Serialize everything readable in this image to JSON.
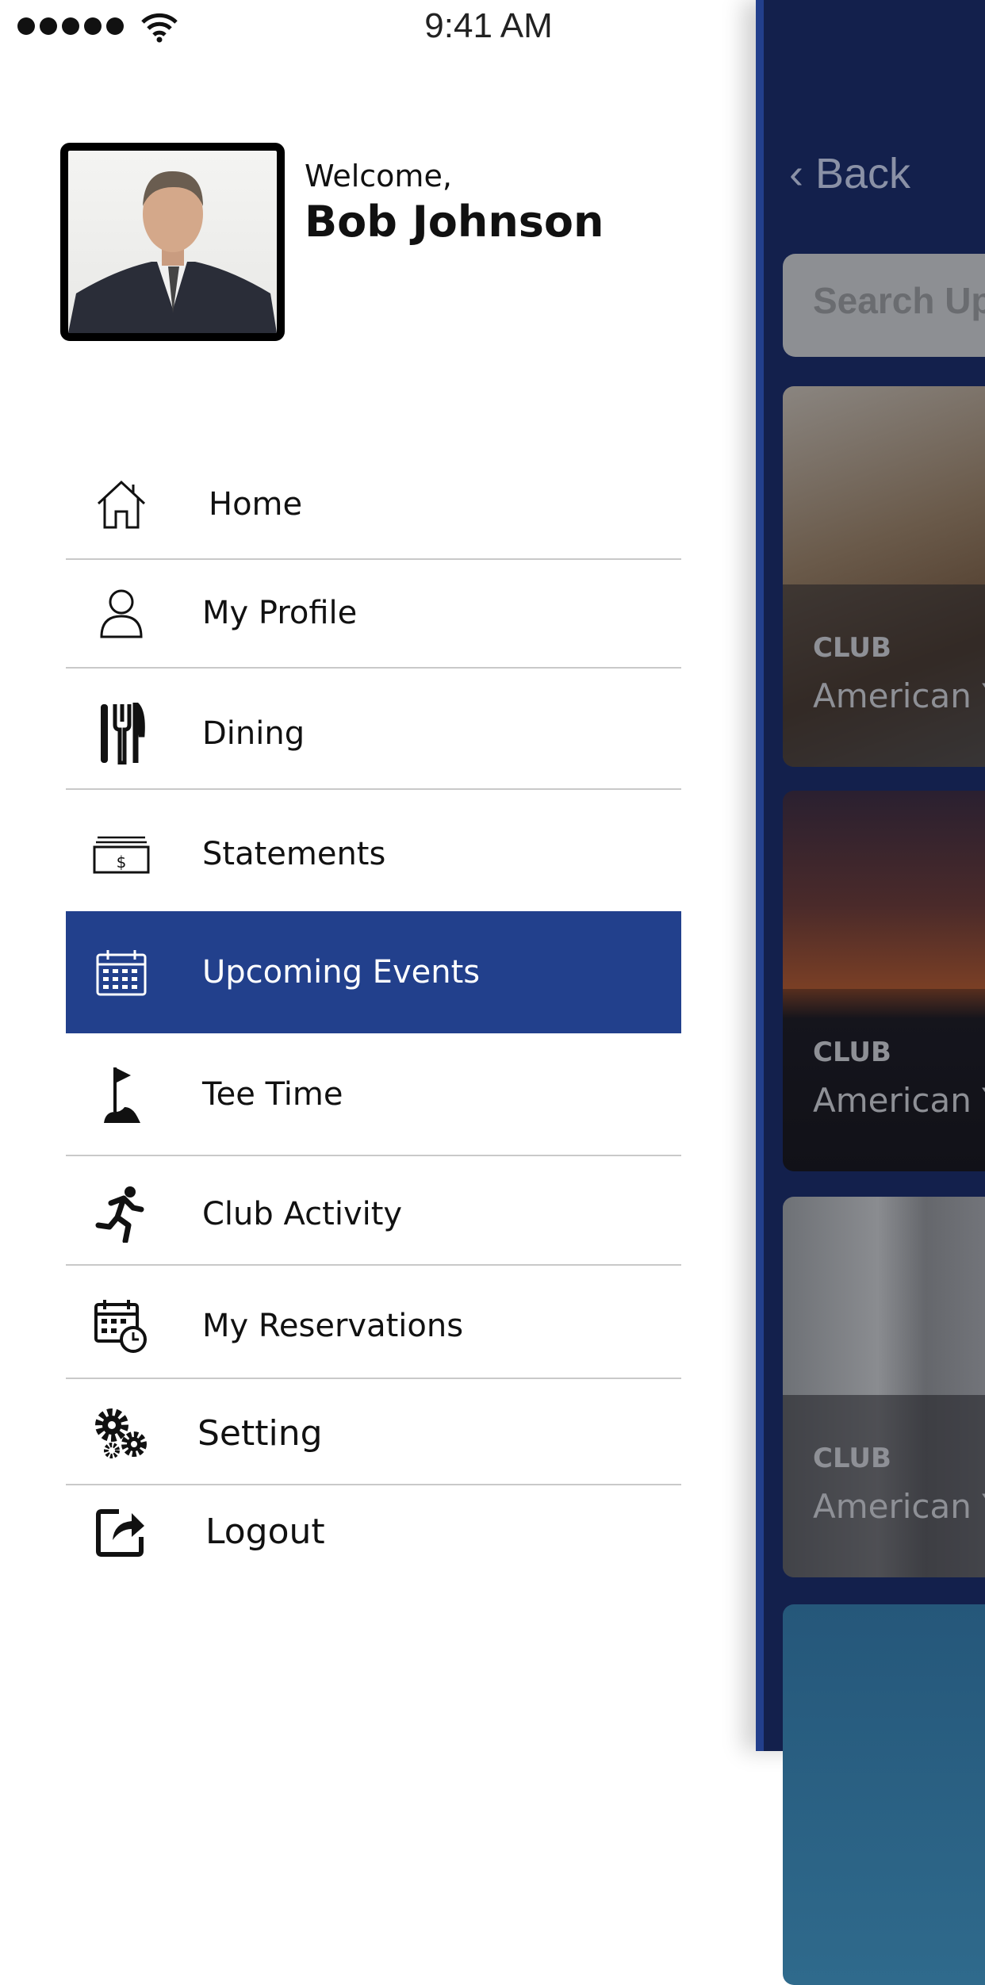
{
  "status_bar": {
    "time": "9:41 AM",
    "signal_dots": 5,
    "icons": [
      "signal-dots-icon",
      "wifi-icon"
    ]
  },
  "drawer": {
    "welcome": "Welcome,",
    "user_name": "Bob Johnson",
    "menu": [
      {
        "label": "Home",
        "icon": "home-icon"
      },
      {
        "label": "My Profile",
        "icon": "user-icon"
      },
      {
        "label": "Dining",
        "icon": "utensils-icon"
      },
      {
        "label": "Statements",
        "icon": "bill-icon"
      },
      {
        "label": "Upcoming Events",
        "icon": "calendar-icon",
        "active": true
      },
      {
        "label": "Tee Time",
        "icon": "golf-flag-icon"
      },
      {
        "label": "Club Activity",
        "icon": "running-icon"
      },
      {
        "label": "My Reservations",
        "icon": "calendar-clock-icon"
      },
      {
        "label": "Setting",
        "icon": "gears-icon"
      },
      {
        "label": "Logout",
        "icon": "logout-icon"
      }
    ],
    "active_color": "#22408c"
  },
  "background_screen": {
    "back_label": "Back",
    "search_placeholder": "Search Up",
    "cards": [
      {
        "category": "CLUB",
        "title": "American Y"
      },
      {
        "category": "CLUB",
        "title": "American Y"
      },
      {
        "category": "CLUB",
        "title": "American Y"
      }
    ],
    "bg_color": "#13204c"
  }
}
